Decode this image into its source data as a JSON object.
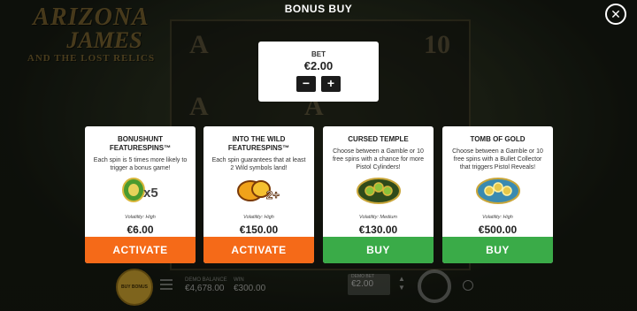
{
  "header": {
    "title": "BONUS BUY",
    "close_icon": "close-icon"
  },
  "logo": {
    "line1": "ARIZONA",
    "line2": "JAMES",
    "line3": "AND THE LOST RELICS"
  },
  "bet": {
    "label": "BET",
    "value": "€2.00",
    "minus_label": "−",
    "plus_label": "+"
  },
  "cards": [
    {
      "title": "BONUSHUNT FEATURESPINS™",
      "description": "Each spin is 5 times more likely to trigger a bonus game!",
      "icon": "bonushunt-icon",
      "icon_text": "x5",
      "volatility": "Volatility: High",
      "price": "€6.00",
      "button": "ACTIVATE",
      "button_color": "#f56a18"
    },
    {
      "title": "INTO THE WILD FEATURESPINS™",
      "description": "Each spin guarantees that at least 2 Wild symbols land!",
      "icon": "wild-icon",
      "icon_text": "2+",
      "volatility": "Volatility: High",
      "price": "€150.00",
      "button": "ACTIVATE",
      "button_color": "#f56a18"
    },
    {
      "title": "CURSED TEMPLE",
      "description": "Choose between a Gamble or 10 free spins with a chance for more Pistol Cylinders!",
      "icon": "cursed-temple-icon",
      "volatility": "Volatility: Medium",
      "price": "€130.00",
      "button": "BUY",
      "button_color": "#3aab48"
    },
    {
      "title": "TOMB OF GOLD",
      "description": "Choose between a Gamble or 10 free spins with a Bullet Collector that triggers Pistol Reveals!",
      "icon": "tomb-of-gold-icon",
      "volatility": "Volatility: High",
      "price": "€500.00",
      "button": "BUY",
      "button_color": "#3aab48"
    }
  ],
  "bottom": {
    "buy_bonus_label": "BUY BONUS",
    "balance_label": "DEMO BALANCE",
    "balance_value": "€4,678.00",
    "win_label": "WIN",
    "win_value": "€300.00",
    "bet_label": "DEMO BET",
    "bet_value": "€2.00"
  },
  "reel_symbols": [
    "A",
    "10",
    "A",
    "A"
  ]
}
